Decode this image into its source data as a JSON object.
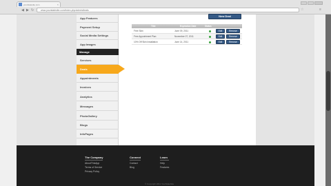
{
  "browser": {
    "tab_title": "yourstatesite.com",
    "address": "www.yourstatesite.com/index.php/admin/deals",
    "back_icon": "back-arrow-icon",
    "forward_icon": "forward-arrow-icon",
    "reload_icon": "reload-icon",
    "star_icon": "bookmark-star-icon",
    "menu_icon": "wrench-icon"
  },
  "sidebar": {
    "top_items": [
      {
        "label": "App Features"
      },
      {
        "label": "Payment Setup"
      },
      {
        "label": "Social Media Settings"
      },
      {
        "label": "App Images"
      }
    ],
    "manage_header": "Manage",
    "manage_items": [
      {
        "label": "Services"
      },
      {
        "label": "Deals",
        "active": true
      },
      {
        "label": "Appointments"
      },
      {
        "label": "Invoices"
      },
      {
        "label": "Analytics"
      },
      {
        "label": "Messages"
      },
      {
        "label": "PhotoGallery"
      },
      {
        "label": "Blogs"
      },
      {
        "label": "InfoPages"
      }
    ]
  },
  "main": {
    "add_button": "New Deal",
    "table": {
      "columns": [
        "Title",
        "Expiration Date",
        "Status"
      ],
      "rows": [
        {
          "title": "Free Skin",
          "date": "June 09, 2011",
          "edit": "Edit",
          "remove": "Remove"
        },
        {
          "title": "Free Appointment Plan",
          "date": "November 07, 2011",
          "edit": "Edit",
          "remove": "Remove"
        },
        {
          "title": "10% Off Skin Installation",
          "date": "June 14, 2011",
          "edit": "Edit",
          "remove": "Remove"
        }
      ]
    },
    "status_color": "#36a13a",
    "accent_color": "#f7a81b",
    "button_color": "#355a86"
  },
  "footer": {
    "columns": [
      {
        "heading": "The Company",
        "links": [
          "AboutThisApp",
          "Terms of Service",
          "Privacy Policy"
        ]
      },
      {
        "heading": "Connect",
        "links": [
          "Contact",
          "Blog"
        ]
      },
      {
        "heading": "Learn",
        "links": [
          "Help",
          "Features"
        ]
      }
    ],
    "copyright": "© Copyright 2011 YourStateSite"
  }
}
